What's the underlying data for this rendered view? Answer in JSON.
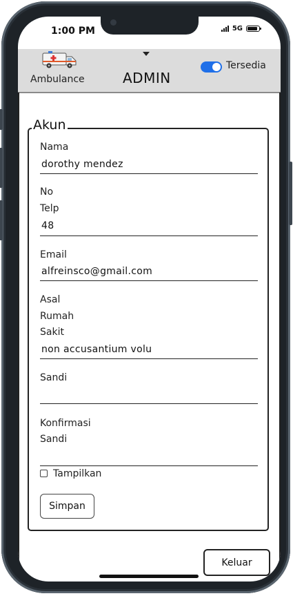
{
  "status_bar": {
    "time": "1:00 PM",
    "network": "5G"
  },
  "app_bar": {
    "brand_label": "Ambulance",
    "title": "ADMIN",
    "availability_label": "Tersedia",
    "availability_on": true
  },
  "form": {
    "legend": "Akun",
    "fields": [
      {
        "label_lines": [
          "Nama"
        ],
        "value": "dorothy mendez"
      },
      {
        "label_lines": [
          "No",
          "Telp"
        ],
        "value": "48"
      },
      {
        "label_lines": [
          "Email"
        ],
        "value": "alfreinsco@gmail.com"
      },
      {
        "label_lines": [
          "Asal",
          "Rumah",
          "Sakit"
        ],
        "value": "non accusantium volu"
      },
      {
        "label_lines": [
          "Sandi"
        ],
        "value": ""
      },
      {
        "label_lines": [
          "Konfirmasi",
          "Sandi"
        ],
        "value": ""
      }
    ],
    "show_password_label": "Tampilkan",
    "show_password_checked": false,
    "save_label": "Simpan"
  },
  "footer": {
    "logout_label": "Keluar"
  },
  "colors": {
    "app_bar_bg": "#dcdcdc",
    "toggle_on": "#1f6fe8",
    "phone_frame": "#1e2328"
  },
  "icons": {
    "brand": "ambulance-icon",
    "menu": "caret-down-icon"
  }
}
